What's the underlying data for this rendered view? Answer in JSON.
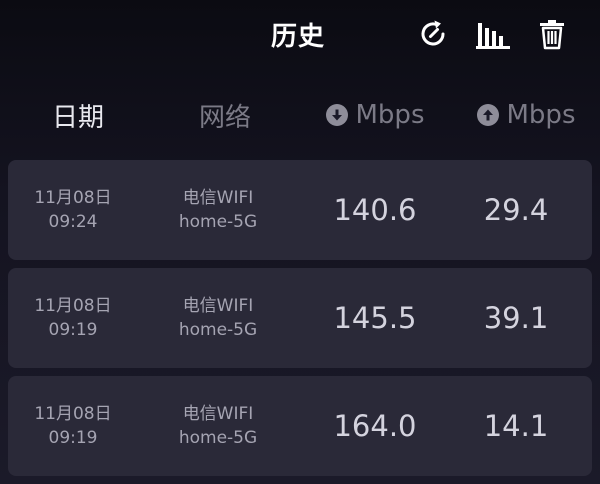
{
  "header": {
    "title": "历史",
    "icons": {
      "refresh": "refresh-icon",
      "chart": "bar-chart-icon",
      "trash": "trash-icon"
    }
  },
  "columns": {
    "date": "日期",
    "network": "网络",
    "download_unit": "Mbps",
    "upload_unit": "Mbps"
  },
  "rows": [
    {
      "date": "11月08日",
      "time": "09:24",
      "network_name": "电信WIFI",
      "ssid": "home-5G",
      "download": "140.6",
      "upload": "29.4"
    },
    {
      "date": "11月08日",
      "time": "09:19",
      "network_name": "电信WIFI",
      "ssid": "home-5G",
      "download": "145.5",
      "upload": "39.1"
    },
    {
      "date": "11月08日",
      "time": "09:19",
      "network_name": "电信WIFI",
      "ssid": "home-5G",
      "download": "164.0",
      "upload": "14.1"
    }
  ],
  "colors": {
    "background_top": "#0b0b12",
    "background_bottom": "#1b1a29",
    "row_background": "#2a2938",
    "active_header": "#e9e9ef",
    "muted_text": "#7b7a86"
  }
}
